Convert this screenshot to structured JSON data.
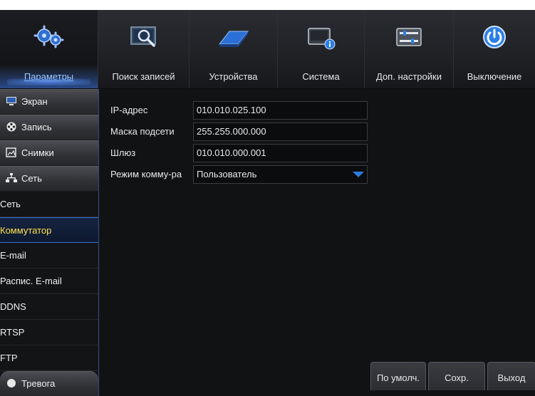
{
  "topnav": {
    "items": [
      {
        "label": "Параметры",
        "icon": "gears-icon"
      },
      {
        "label": "Поиск записей",
        "icon": "search-records-icon"
      },
      {
        "label": "Устройства",
        "icon": "hdd-icon"
      },
      {
        "label": "Система",
        "icon": "system-info-icon"
      },
      {
        "label": "Доп. настройки",
        "icon": "advanced-settings-icon"
      },
      {
        "label": "Выключение",
        "icon": "power-icon"
      }
    ],
    "active": "Параметры"
  },
  "sidebar": {
    "sections": [
      {
        "label": "Экран",
        "icon": "monitor-icon"
      },
      {
        "label": "Запись",
        "icon": "film-reel-icon"
      },
      {
        "label": "Снимки",
        "icon": "snapshot-icon"
      },
      {
        "label": "Сеть",
        "icon": "network-icon"
      }
    ],
    "sub_items": [
      "Сеть",
      "Коммутатор",
      "E-mail",
      "Распис. E-mail",
      "DDNS",
      "RTSP",
      "FTP"
    ],
    "active_sub": "Коммутатор",
    "partial_next": "Тревога"
  },
  "form": {
    "ip_label": "IP-адрес",
    "ip_value": "010.010.025.100",
    "mask_label": "Маска подсети",
    "mask_value": "255.255.000.000",
    "gateway_label": "Шлюз",
    "gateway_value": "010.010.000.001",
    "mode_label": "Режим комму-ра",
    "mode_value": "Пользователь"
  },
  "buttons": {
    "default": "По умолч.",
    "save": "Сохр.",
    "exit": "Выход"
  },
  "colors": {
    "accent": "#2e7de0",
    "active_text": "#ffe14d",
    "background": "#111214"
  }
}
